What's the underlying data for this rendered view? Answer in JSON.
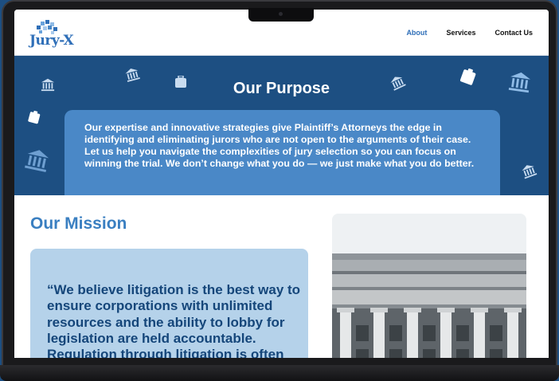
{
  "brand": {
    "name": "Jury-X"
  },
  "nav": {
    "items": [
      {
        "label": "About",
        "active": true
      },
      {
        "label": "Services",
        "active": false
      },
      {
        "label": "Contact Us",
        "active": false
      }
    ]
  },
  "purpose": {
    "title": "Our Purpose",
    "body": "Our expertise and innovative strategies give Plaintiff’s Attorneys the edge in identifying and eliminating jurors who are not open to the arguments of their case. Let us help you navigate the complexities of jury selection so you can focus on winning the trial. We don’t change what you do — we just make what you do better."
  },
  "mission": {
    "title": "Our Mission",
    "quote": "“We believe litigation is the best way to ensure corporations with unlimited resources and the ability to lobby for legislation are held accountable. Regulation through litigation is often"
  },
  "colors": {
    "accent": "#2f6fb8",
    "band": "#1d4f82",
    "box": "#4a88c7",
    "quote_bg": "#b5d2ea",
    "quote_text": "#15467a"
  },
  "icons": [
    "courthouse-icon",
    "briefcase-icon",
    "gavel-icon",
    "clipboard-icon"
  ]
}
